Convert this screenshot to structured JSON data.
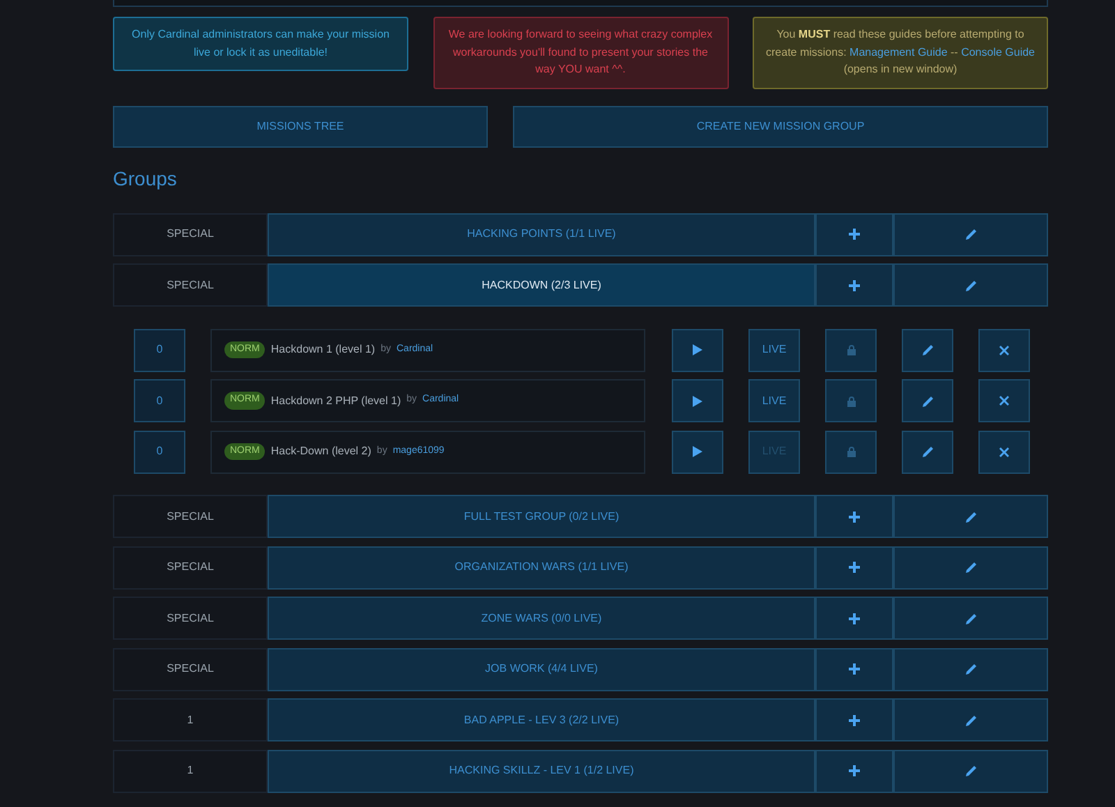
{
  "notes": [
    {
      "kind": "info",
      "text": "Only Cardinal administrators can make your mission live or lock it as uneditable!"
    },
    {
      "kind": "danger",
      "text": "We are looking forward to seeing what crazy complex workarounds you'll found to present your stories the way YOU want ^^."
    },
    {
      "kind": "warning",
      "parts": [
        {
          "kind": "text",
          "text": "You **MUST** read these guides before attempting to create missions: "
        },
        {
          "kind": "link",
          "text": "Management Guide"
        },
        {
          "kind": "text",
          "text": " -- "
        },
        {
          "kind": "link",
          "text": "Console Guide"
        },
        {
          "kind": "text",
          "text": " (opens in new window)"
        }
      ]
    }
  ],
  "actions": [
    "MISSIONS TREE",
    "CREATE NEW MISSION GROUP"
  ],
  "heading": "Groups",
  "groups": [
    {
      "type": "SPECIAL",
      "name": "HACKING POINTS (1/1 LIVE)",
      "expanded": false
    },
    {
      "type": "SPECIAL",
      "name": "HACKDOWN (2/3 LIVE)",
      "expanded": true,
      "missions": [
        {
          "count": "0",
          "badge": "NORM",
          "title": "Hackdown 1 (level 1)",
          "by": "by",
          "author": "Cardinal",
          "live_label": "LIVE",
          "live": true
        },
        {
          "count": "0",
          "badge": "NORM",
          "title": "Hackdown 2 PHP (level 1)",
          "by": "by",
          "author": "Cardinal",
          "live_label": "LIVE",
          "live": true
        },
        {
          "count": "0",
          "badge": "NORM",
          "title": "Hack-Down (level 2)",
          "by": "by",
          "author": "mage61099",
          "live_label": "LIVE",
          "live": false
        }
      ]
    },
    {
      "type": "SPECIAL",
      "name": "FULL TEST GROUP (0/2 LIVE)",
      "expanded": false
    },
    {
      "type": "SPECIAL",
      "name": "ORGANIZATION WARS (1/1 LIVE)",
      "expanded": false
    },
    {
      "type": "SPECIAL",
      "name": "ZONE WARS (0/0 LIVE)",
      "expanded": false
    },
    {
      "type": "SPECIAL",
      "name": "JOB WORK (4/4 LIVE)",
      "expanded": false
    },
    {
      "type": "1",
      "name": "BAD APPLE - LEV 3 (2/2 LIVE)",
      "expanded": false
    },
    {
      "type": "1",
      "name": "HACKING SKILLZ - LEV 1 (1/2 LIVE)",
      "expanded": false
    }
  ]
}
